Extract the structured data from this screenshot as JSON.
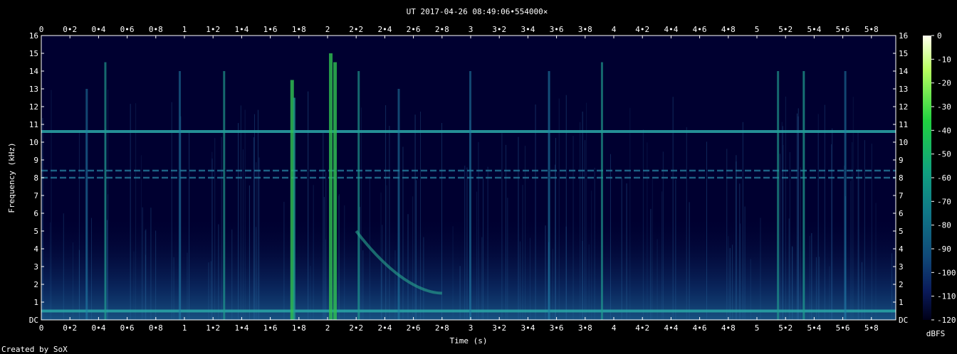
{
  "chart_data": {
    "type": "heatmap",
    "title": "UT 2017-04-26 08:49:06•554000×",
    "xlabel": "Time (s)",
    "ylabel": "Frequency (kHz)",
    "xlim": [
      0,
      5.98
    ],
    "ylim": [
      0,
      16
    ],
    "x_ticks": [
      "0",
      "0•2",
      "0•4",
      "0•6",
      "0•8",
      "1",
      "1•2",
      "1•4",
      "1•6",
      "1•8",
      "2",
      "2•2",
      "2•4",
      "2•6",
      "2•8",
      "3",
      "3•2",
      "3•4",
      "3•6",
      "3•8",
      "4",
      "4•2",
      "4•4",
      "4•6",
      "4•8",
      "5",
      "5•2",
      "5•4",
      "5•6",
      "5•8"
    ],
    "y_ticks": [
      "DC",
      "1",
      "2",
      "3",
      "4",
      "5",
      "6",
      "7",
      "8",
      "9",
      "10",
      "11",
      "12",
      "13",
      "14",
      "15",
      "16"
    ],
    "colorbar": {
      "label": "dBFS",
      "range": [
        -120,
        0
      ],
      "ticks": [
        "0",
        "-10",
        "-20",
        "-30",
        "-40",
        "-50",
        "-60",
        "-70",
        "-80",
        "-90",
        "-100",
        "-110",
        "-120"
      ]
    },
    "tones_khz": [
      10.6,
      8.4,
      8.0,
      0.5
    ],
    "vertical_bursts": [
      {
        "t": 0.45,
        "fmax": 14.5,
        "strength": 0.6
      },
      {
        "t": 0.32,
        "fmax": 13.0,
        "strength": 0.4
      },
      {
        "t": 0.97,
        "fmax": 14.0,
        "strength": 0.4
      },
      {
        "t": 1.28,
        "fmax": 14.0,
        "strength": 0.6
      },
      {
        "t": 1.75,
        "fmax": 13.5,
        "strength": 0.95
      },
      {
        "t": 1.77,
        "fmax": 12.5,
        "strength": 0.8
      },
      {
        "t": 2.02,
        "fmax": 15.0,
        "strength": 0.9
      },
      {
        "t": 2.05,
        "fmax": 14.5,
        "strength": 0.9
      },
      {
        "t": 2.22,
        "fmax": 14.0,
        "strength": 0.6
      },
      {
        "t": 2.5,
        "fmax": 13.0,
        "strength": 0.4
      },
      {
        "t": 3.0,
        "fmax": 14.0,
        "strength": 0.4
      },
      {
        "t": 3.55,
        "fmax": 14.0,
        "strength": 0.5
      },
      {
        "t": 3.92,
        "fmax": 14.5,
        "strength": 0.6
      },
      {
        "t": 5.15,
        "fmax": 14.0,
        "strength": 0.6
      },
      {
        "t": 5.33,
        "fmax": 14.0,
        "strength": 0.7
      },
      {
        "t": 5.62,
        "fmax": 14.0,
        "strength": 0.4
      }
    ],
    "dispersive_whistler": {
      "t_start": 2.2,
      "t_end": 2.8,
      "f_start_khz": 5.0,
      "f_end_khz": 1.5
    }
  },
  "footer": {
    "credit": "Created by SoX"
  }
}
